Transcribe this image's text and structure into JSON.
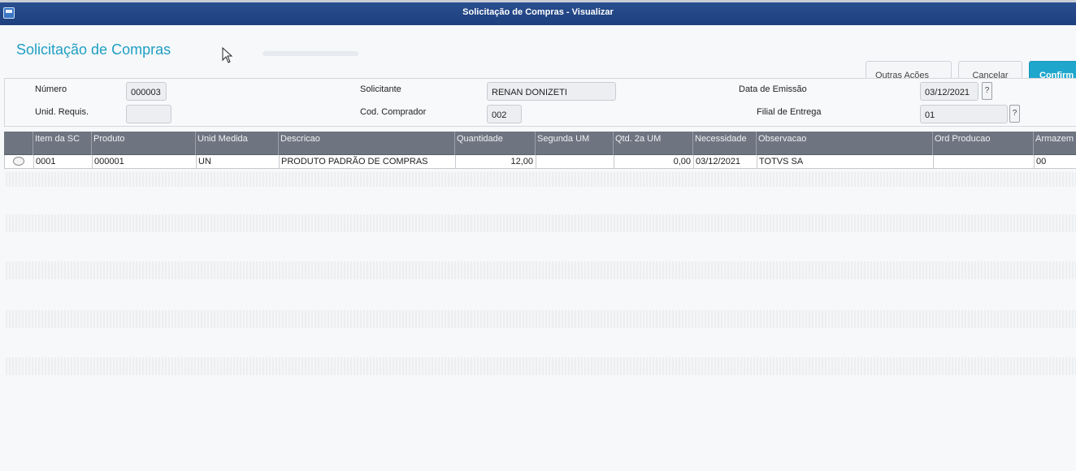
{
  "window": {
    "title": "Solicitação de Compras - Visualizar",
    "app_icon": "window-icon"
  },
  "header": {
    "title": "Solicitação de Compras",
    "buttons": {
      "other_actions": "Outras Ações",
      "cancel": "Cancelar",
      "confirm": "Confirm"
    }
  },
  "form": {
    "numero": {
      "label": "Número",
      "value": "000003"
    },
    "unid_requis": {
      "label": "Unid. Requis.",
      "value": ""
    },
    "solicitante": {
      "label": "Solicitante",
      "value": "RENAN DONIZETI"
    },
    "cod_comprador": {
      "label": "Cod. Comprador",
      "value": "002"
    },
    "data_emissao": {
      "label": "Data de Emissão",
      "value": "03/12/2021"
    },
    "filial_entrega": {
      "label": "Filial de Entrega",
      "value": "01"
    },
    "help_label": "?"
  },
  "grid": {
    "columns": [
      "Item da SC",
      "Produto",
      "Unid Medida",
      "Descricao",
      "Quantidade",
      "Segunda UM",
      "Qtd. 2a UM",
      "Necessidade",
      "Observacao",
      "Ord Producao",
      "Armazem"
    ],
    "rows": [
      [
        "0001",
        "000001",
        "UN",
        "PRODUTO PADRÃO DE COMPRAS",
        "12,00",
        "",
        "0,00",
        "03/12/2021",
        "TOTVS SA",
        "",
        "00"
      ]
    ]
  },
  "colors": {
    "accent": "#1f9fc3",
    "titlebar": "#1d3f7e",
    "grid_header": "#6e7580",
    "confirm": "#1ea6cc"
  }
}
